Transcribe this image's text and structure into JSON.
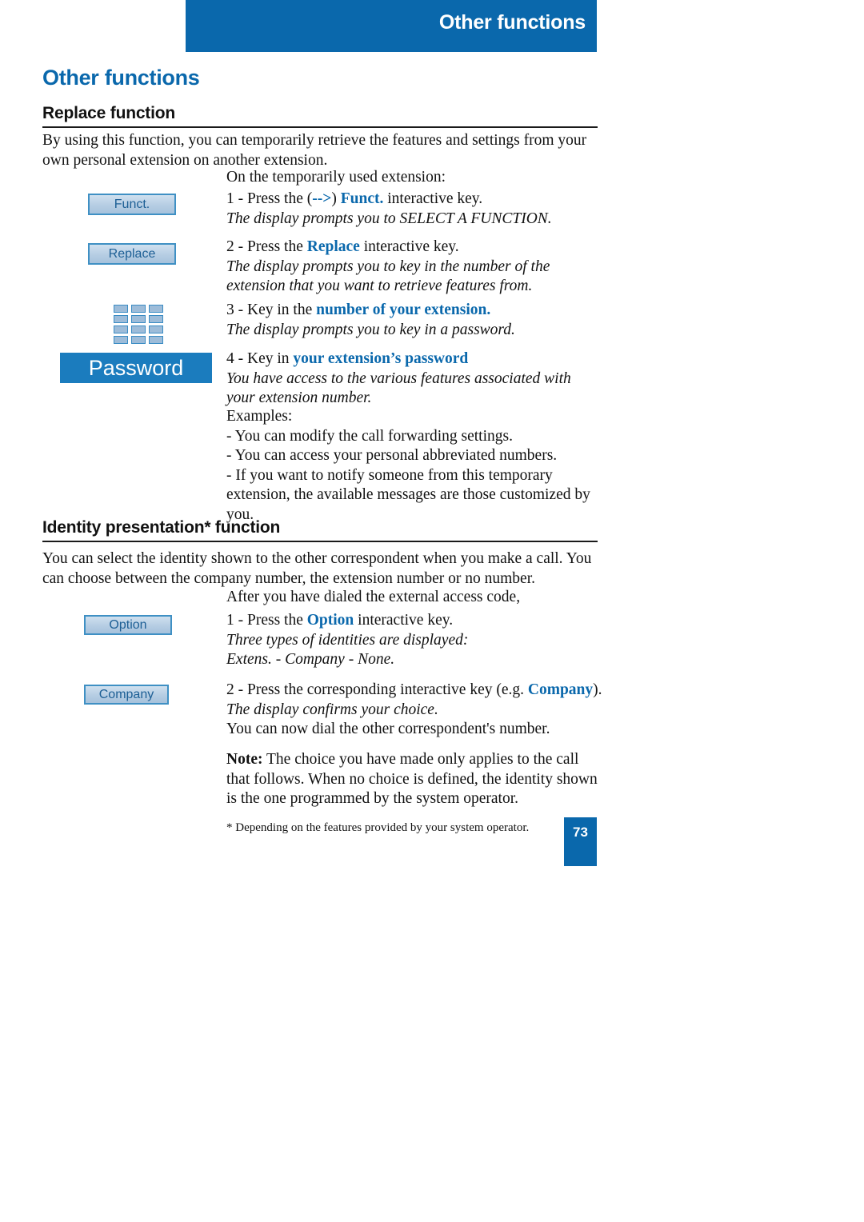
{
  "colors": {
    "brand_blue": "#0a68ac",
    "display_blue": "#1b7cbe",
    "softkey_fill": "#b6cde3",
    "softkey_border": "#3f90c4",
    "text_black": "#111111"
  },
  "header": {
    "banner_title": "Other functions"
  },
  "chapter": {
    "title": "Other functions"
  },
  "sections": [
    {
      "id": "replace-function",
      "title": "Replace function",
      "intro": "By using this function, you can temporarily retrieve the features and settings from your own personal extension on another extension.",
      "lead_in": "On the temporarily used extension:",
      "steps": [
        {
          "number": "1",
          "softkey": "Funct.",
          "line_prefix": "1 - Press the ",
          "arrow_glyph": "-->",
          "key_label": "Funct.",
          "line_suffix": " interactive key.",
          "result": "The display prompts you to SELECT A FUNCTION."
        },
        {
          "number": "2",
          "softkey": "Replace",
          "line_prefix": "2 - Press the ",
          "key_label": "Replace",
          "line_suffix": " interactive key.",
          "result": "The display prompts you to key in the number of the extension that you want to retrieve features from."
        },
        {
          "number": "3",
          "icon": "keypad-icon",
          "line_prefix": "3 - Key in the ",
          "key_label": "number of your extension.",
          "line_suffix": "",
          "result": "The display prompts you to key in a password."
        },
        {
          "number": "4",
          "display": "Password",
          "line_prefix": "4 - Key in ",
          "key_label": "your extension’s password",
          "line_suffix": "",
          "result": "You have access to the various features associated with your extension number."
        }
      ],
      "examples_label": "Examples:",
      "examples": [
        "- You can modify the call forwarding settings.",
        "- You can access your personal abbreviated numbers.",
        "- If you want to notify someone from this temporary extension, the available messages are those customized by you."
      ]
    },
    {
      "id": "identity-presentation-function",
      "title": "Identity presentation* function",
      "intro": "You can select the identity shown to the other correspondent when you make a call. You can choose between the company number, the extension number or no number.",
      "lead_in": "After you have dialed the external access code,",
      "steps": [
        {
          "number": "1",
          "softkey": "Option",
          "line_prefix": "1 - Press the ",
          "key_label": "Option",
          "line_suffix": " interactive key.",
          "result_line_1": "Three types of identities are displayed:",
          "result_line_2": "Extens. - Company - None."
        },
        {
          "number": "2",
          "softkey": "Company",
          "line_prefix": "2 - Press the corresponding interactive key (e.g. ",
          "key_label": "Company",
          "line_suffix": ").",
          "result": "The display confirms your choice.",
          "extra": "You can now dial the other correspondent's number."
        }
      ],
      "note": {
        "label": "Note:",
        "text": " The choice you have made only applies to the call that follows. When no choice is defined, the identity shown is the one programmed by the system operator."
      }
    }
  ],
  "footnote": "* Depending on the features provided by your system operator.",
  "page_number": "73"
}
